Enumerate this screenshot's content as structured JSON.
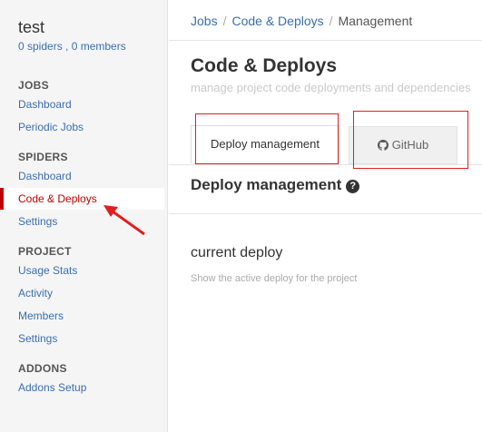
{
  "sidebar": {
    "project_name": "test",
    "project_meta": "0 spiders , 0 members",
    "sections": [
      {
        "title": "JOBS",
        "items": [
          "Dashboard",
          "Periodic Jobs"
        ]
      },
      {
        "title": "SPIDERS",
        "items": [
          "Dashboard",
          "Code & Deploys",
          "Settings"
        ]
      },
      {
        "title": "PROJECT",
        "items": [
          "Usage Stats",
          "Activity",
          "Members",
          "Settings"
        ]
      },
      {
        "title": "ADDONS",
        "items": [
          "Addons Setup"
        ]
      }
    ],
    "active_item": "Code & Deploys"
  },
  "breadcrumb": {
    "items": [
      "Jobs",
      "Code & Deploys",
      "Management"
    ],
    "separator": "/"
  },
  "page": {
    "title": "Code & Deploys",
    "subtitle": "manage project code deployments and dependencies"
  },
  "tabs": [
    {
      "label": "Deploy management",
      "active": true
    },
    {
      "label": "GitHub",
      "icon": "github-icon",
      "active": false
    }
  ],
  "content": {
    "heading": "Deploy management",
    "help_icon": "?",
    "current_deploy_title": "current deploy",
    "current_deploy_desc": "Show the active deploy for the project"
  },
  "colors": {
    "link": "#3b6eb3",
    "active": "#c00000",
    "annotation": "#e02020",
    "sidebar_bg": "#f5f5f5"
  }
}
